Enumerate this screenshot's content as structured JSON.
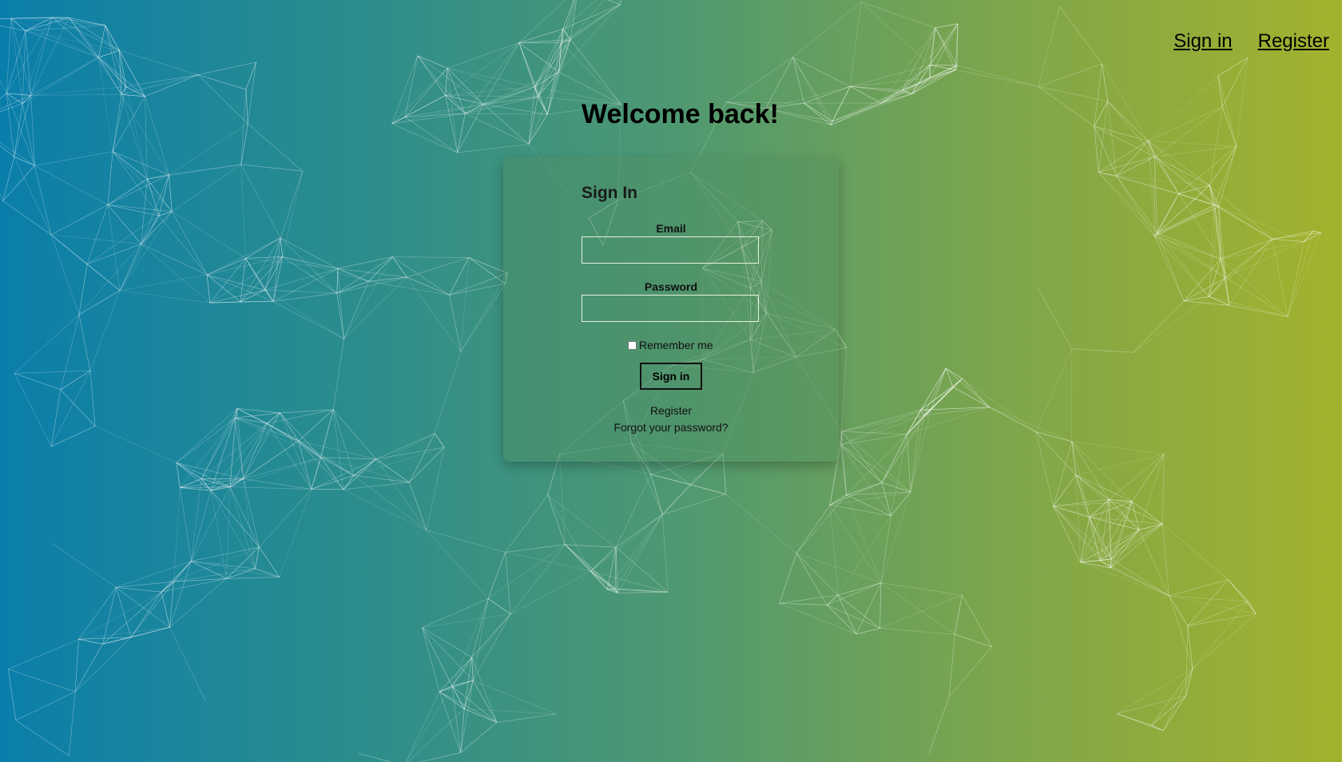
{
  "nav": {
    "sign_in": "Sign in",
    "register": "Register"
  },
  "page": {
    "title": "Welcome back!"
  },
  "form": {
    "heading": "Sign In",
    "email_label": "Email",
    "email_value": "",
    "password_label": "Password",
    "password_value": "",
    "remember_label": "Remember me",
    "remember_checked": false,
    "submit_label": "Sign in",
    "register_link": "Register",
    "forgot_link": "Forgot your password?"
  },
  "colors": {
    "gradient_start": "#0a7eab",
    "gradient_end": "#a3b22d",
    "mesh_line": "#ffffff"
  }
}
